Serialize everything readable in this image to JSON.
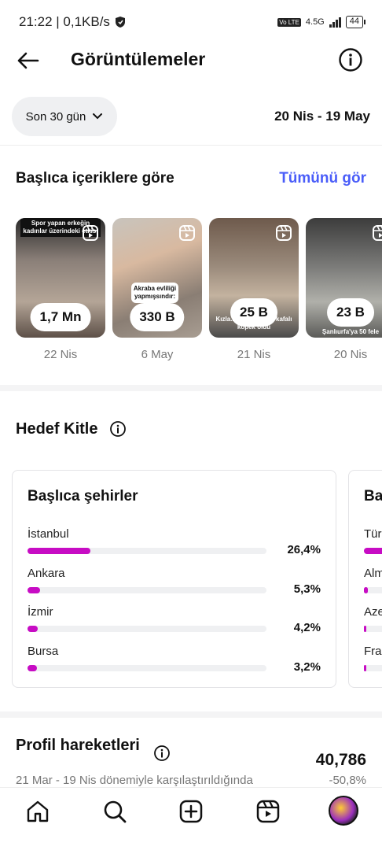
{
  "status_bar": {
    "time_speed": "21:22 | 0,1KB/s",
    "network": "4.5G",
    "volte": "Vo LTE",
    "battery": "44"
  },
  "header": {
    "title": "Görüntülemeler"
  },
  "filters": {
    "period_label": "Son 30 gün",
    "date_range": "20 Nis - 19 May"
  },
  "top_content": {
    "title": "Başlıca içeriklere göre",
    "see_all": "Tümünü gör",
    "items": [
      {
        "views": "1,7 Mn",
        "date": "22 Nis",
        "caption": "Spor yapan erkeğin kadınlar üzerindeki etkisi"
      },
      {
        "views": "330 B",
        "date": "6 May",
        "caption": "Akraba evliliği yapmışsındır:"
      },
      {
        "views": "25 B",
        "date": "21 Nis",
        "caption": "Kızla... fotoğ... ayak kafalı köpek oldu"
      },
      {
        "views": "23 B",
        "date": "20 Nis",
        "caption": "Şanlıurfa'ya 50 fele"
      }
    ]
  },
  "audience": {
    "title": "Hedef Kitle",
    "cities": {
      "title": "Başlıca şehirler",
      "items": [
        {
          "name": "İstanbul",
          "pct": "26,4%",
          "value": 26.4
        },
        {
          "name": "Ankara",
          "pct": "5,3%",
          "value": 5.3
        },
        {
          "name": "İzmir",
          "pct": "4,2%",
          "value": 4.2
        },
        {
          "name": "Bursa",
          "pct": "3,2%",
          "value": 3.2
        }
      ]
    },
    "countries": {
      "title": "Ba",
      "items": [
        {
          "name": "Türk",
          "value": 90
        },
        {
          "name": "Alm",
          "value": 6
        },
        {
          "name": "Aze",
          "value": 3
        },
        {
          "name": "Fran",
          "value": 2
        }
      ]
    }
  },
  "profile_activity": {
    "title": "Profil hareketleri",
    "value": "40,786",
    "comparison": "21 Mar - 19 Nis dönemiyle karşılaştırıldığında",
    "change": "-50,8%"
  },
  "colors": {
    "accent": "#4a5df9",
    "bar": "#c70cc4",
    "track": "#eff0f2"
  },
  "icons": [
    "back-arrow-icon",
    "info-icon",
    "chevron-down-icon",
    "reel-icon",
    "home-icon",
    "search-icon",
    "create-icon",
    "reels-icon",
    "profile-avatar"
  ]
}
